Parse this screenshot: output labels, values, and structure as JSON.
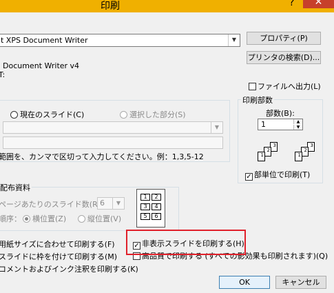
{
  "window": {
    "title": "印刷",
    "help": "?",
    "close": "✕"
  },
  "printer": {
    "name": "t XPS Document Writer",
    "status": "Document Writer v4",
    "type_label": "T:",
    "properties_button": "プロパティ(P)",
    "find_printer_button": "プリンタの検索(D)...",
    "print_to_file_label": "ファイルへ出力(L)"
  },
  "range": {
    "current_slide": "現在のスライド(C)",
    "selection": "選択した部分(S)",
    "slides_value": "",
    "hint": "範囲を、カンマで区切って入力してください。例：1,3,5-12"
  },
  "copies": {
    "group_label": "印刷部数",
    "count_label": "部数(B):",
    "count_value": "1",
    "collate_label": "部単位で印刷(T)",
    "page_digits": [
      "1",
      "2",
      "3",
      "1",
      "2",
      "3"
    ]
  },
  "handouts": {
    "group_label": "配布資料",
    "per_page_label": "ページあたりのスライド数(R):",
    "per_page_value": "6",
    "order_label": "順序：",
    "horizontal": "横位置(Z)",
    "vertical": "縦位置(V)",
    "layout_cells": [
      "1",
      "2",
      "3",
      "4",
      "5",
      "6"
    ]
  },
  "options": {
    "fit_to_paper": "用紙サイズに合わせて印刷する(F)",
    "frame_slides": "スライドに枠を付けて印刷する(M)",
    "comments": "コメントおよびインク注釈を印刷する(K)",
    "hidden_slides": "非表示スライドを印刷する(H)",
    "high_quality": "高品質で印刷する (すべての影効果も印刷されます)(Q)",
    "hidden_slides_checked": true
  },
  "footer": {
    "ok": "OK",
    "cancel": "キャンセル"
  }
}
